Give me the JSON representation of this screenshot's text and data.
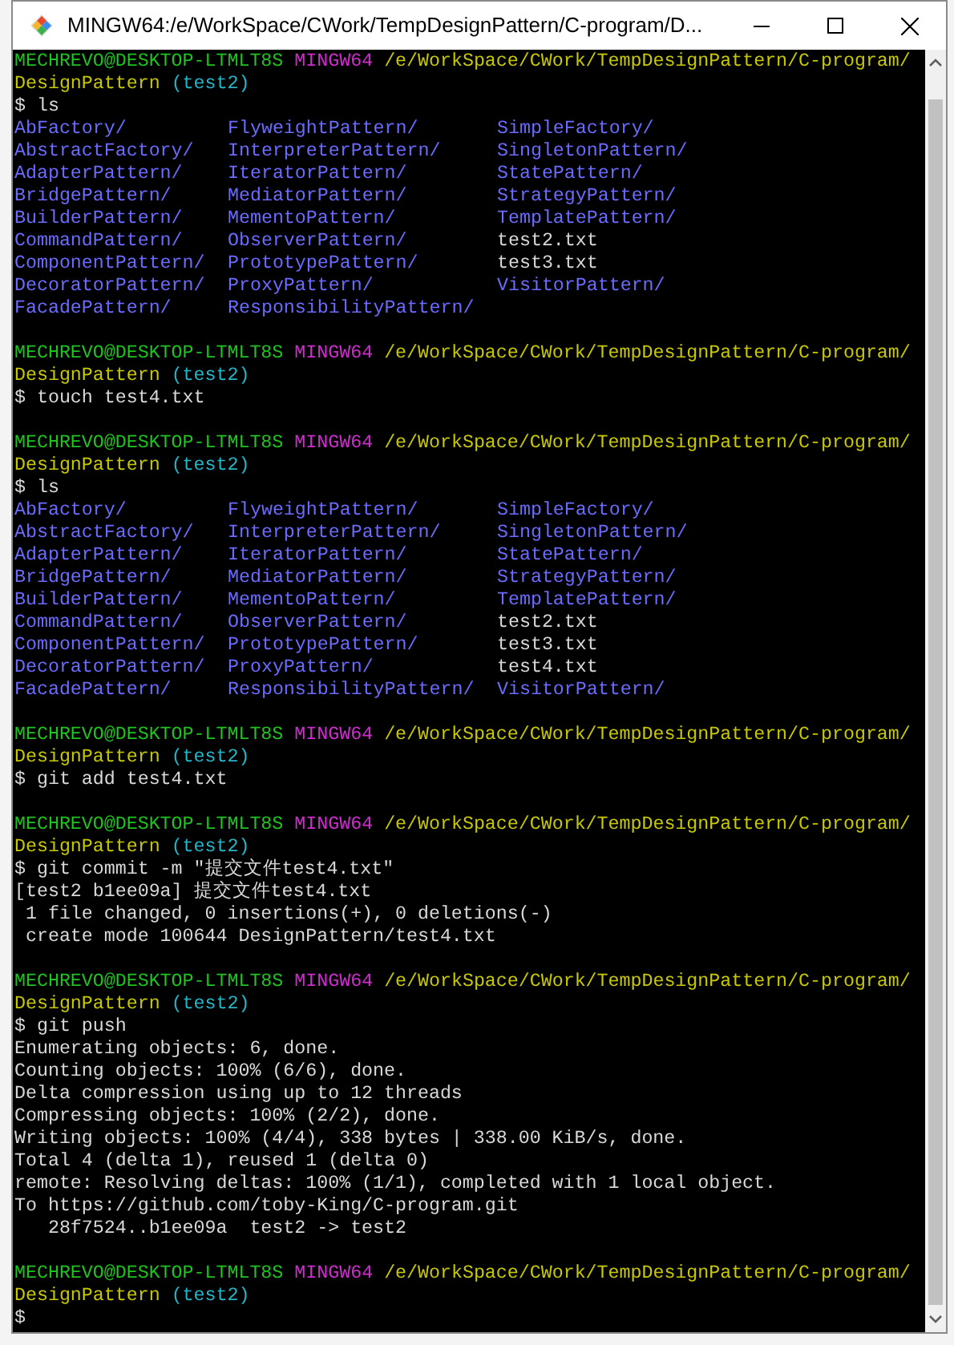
{
  "window": {
    "title": "MINGW64:/e/WorkSpace/CWork/TempDesignPattern/C-program/D..."
  },
  "sessions": [
    {
      "prompt": {
        "user": "MECHREVO@DESKTOP-LTMLT8S",
        "system": "MINGW64",
        "path": "/e/WorkSpace/CWork/TempDesignPattern/C-program/",
        "path_continued": "DesignPattern",
        "branch": "(test2)"
      },
      "command": "$ ls",
      "output": [
        {
          "kind": "listing",
          "rows": [
            [
              {
                "name": "AbFactory/",
                "kind": "dir"
              },
              {
                "name": "FlyweightPattern/",
                "kind": "dir"
              },
              {
                "name": "SimpleFactory/",
                "kind": "dir"
              }
            ],
            [
              {
                "name": "AbstractFactory/",
                "kind": "dir"
              },
              {
                "name": "InterpreterPattern/",
                "kind": "dir"
              },
              {
                "name": "SingletonPattern/",
                "kind": "dir"
              }
            ],
            [
              {
                "name": "AdapterPattern/",
                "kind": "dir"
              },
              {
                "name": "IteratorPattern/",
                "kind": "dir"
              },
              {
                "name": "StatePattern/",
                "kind": "dir"
              }
            ],
            [
              {
                "name": "BridgePattern/",
                "kind": "dir"
              },
              {
                "name": "MediatorPattern/",
                "kind": "dir"
              },
              {
                "name": "StrategyPattern/",
                "kind": "dir"
              }
            ],
            [
              {
                "name": "BuilderPattern/",
                "kind": "dir"
              },
              {
                "name": "MementoPattern/",
                "kind": "dir"
              },
              {
                "name": "TemplatePattern/",
                "kind": "dir"
              }
            ],
            [
              {
                "name": "CommandPattern/",
                "kind": "dir"
              },
              {
                "name": "ObserverPattern/",
                "kind": "dir"
              },
              {
                "name": "test2.txt",
                "kind": "file"
              }
            ],
            [
              {
                "name": "ComponentPattern/",
                "kind": "dir"
              },
              {
                "name": "PrototypePattern/",
                "kind": "dir"
              },
              {
                "name": "test3.txt",
                "kind": "file"
              }
            ],
            [
              {
                "name": "DecoratorPattern/",
                "kind": "dir"
              },
              {
                "name": "ProxyPattern/",
                "kind": "dir"
              },
              {
                "name": "VisitorPattern/",
                "kind": "dir"
              }
            ],
            [
              {
                "name": "FacadePattern/",
                "kind": "dir"
              },
              {
                "name": "ResponsibilityPattern/",
                "kind": "dir"
              }
            ]
          ]
        }
      ]
    },
    {
      "prompt": {
        "user": "MECHREVO@DESKTOP-LTMLT8S",
        "system": "MINGW64",
        "path": "/e/WorkSpace/CWork/TempDesignPattern/C-program/",
        "path_continued": "DesignPattern",
        "branch": "(test2)"
      },
      "command": "$ touch test4.txt"
    },
    {
      "prompt": {
        "user": "MECHREVO@DESKTOP-LTMLT8S",
        "system": "MINGW64",
        "path": "/e/WorkSpace/CWork/TempDesignPattern/C-program/",
        "path_continued": "DesignPattern",
        "branch": "(test2)"
      },
      "command": "$ ls",
      "output": [
        {
          "kind": "listing",
          "rows": [
            [
              {
                "name": "AbFactory/",
                "kind": "dir"
              },
              {
                "name": "FlyweightPattern/",
                "kind": "dir"
              },
              {
                "name": "SimpleFactory/",
                "kind": "dir"
              }
            ],
            [
              {
                "name": "AbstractFactory/",
                "kind": "dir"
              },
              {
                "name": "InterpreterPattern/",
                "kind": "dir"
              },
              {
                "name": "SingletonPattern/",
                "kind": "dir"
              }
            ],
            [
              {
                "name": "AdapterPattern/",
                "kind": "dir"
              },
              {
                "name": "IteratorPattern/",
                "kind": "dir"
              },
              {
                "name": "StatePattern/",
                "kind": "dir"
              }
            ],
            [
              {
                "name": "BridgePattern/",
                "kind": "dir"
              },
              {
                "name": "MediatorPattern/",
                "kind": "dir"
              },
              {
                "name": "StrategyPattern/",
                "kind": "dir"
              }
            ],
            [
              {
                "name": "BuilderPattern/",
                "kind": "dir"
              },
              {
                "name": "MementoPattern/",
                "kind": "dir"
              },
              {
                "name": "TemplatePattern/",
                "kind": "dir"
              }
            ],
            [
              {
                "name": "CommandPattern/",
                "kind": "dir"
              },
              {
                "name": "ObserverPattern/",
                "kind": "dir"
              },
              {
                "name": "test2.txt",
                "kind": "file"
              }
            ],
            [
              {
                "name": "ComponentPattern/",
                "kind": "dir"
              },
              {
                "name": "PrototypePattern/",
                "kind": "dir"
              },
              {
                "name": "test3.txt",
                "kind": "file"
              }
            ],
            [
              {
                "name": "DecoratorPattern/",
                "kind": "dir"
              },
              {
                "name": "ProxyPattern/",
                "kind": "dir"
              },
              {
                "name": "test4.txt",
                "kind": "file"
              }
            ],
            [
              {
                "name": "FacadePattern/",
                "kind": "dir"
              },
              {
                "name": "ResponsibilityPattern/",
                "kind": "dir"
              },
              {
                "name": "VisitorPattern/",
                "kind": "dir"
              }
            ]
          ]
        }
      ]
    },
    {
      "prompt": {
        "user": "MECHREVO@DESKTOP-LTMLT8S",
        "system": "MINGW64",
        "path": "/e/WorkSpace/CWork/TempDesignPattern/C-program/",
        "path_continued": "DesignPattern",
        "branch": "(test2)"
      },
      "command": "$ git add test4.txt"
    },
    {
      "prompt": {
        "user": "MECHREVO@DESKTOP-LTMLT8S",
        "system": "MINGW64",
        "path": "/e/WorkSpace/CWork/TempDesignPattern/C-program/",
        "path_continued": "DesignPattern",
        "branch": "(test2)"
      },
      "command": "$ git commit -m \"提交文件test4.txt\"",
      "output": [
        {
          "kind": "text",
          "lines": [
            "[test2 b1ee09a] 提交文件test4.txt",
            " 1 file changed, 0 insertions(+), 0 deletions(-)",
            " create mode 100644 DesignPattern/test4.txt"
          ]
        }
      ]
    },
    {
      "prompt": {
        "user": "MECHREVO@DESKTOP-LTMLT8S",
        "system": "MINGW64",
        "path": "/e/WorkSpace/CWork/TempDesignPattern/C-program/",
        "path_continued": "DesignPattern",
        "branch": "(test2)"
      },
      "command": "$ git push",
      "output": [
        {
          "kind": "text",
          "lines": [
            "Enumerating objects: 6, done.",
            "Counting objects: 100% (6/6), done.",
            "Delta compression using up to 12 threads",
            "Compressing objects: 100% (2/2), done.",
            "Writing objects: 100% (4/4), 338 bytes | 338.00 KiB/s, done.",
            "Total 4 (delta 1), reused 1 (delta 0)",
            "remote: Resolving deltas: 100% (1/1), completed with 1 local object.",
            "To https://github.com/toby-King/C-program.git",
            "   28f7524..b1ee09a  test2 -> test2"
          ]
        }
      ]
    },
    {
      "prompt": {
        "user": "MECHREVO@DESKTOP-LTMLT8S",
        "system": "MINGW64",
        "path": "/e/WorkSpace/CWork/TempDesignPattern/C-program/",
        "path_continued": "DesignPattern",
        "branch": "(test2)"
      },
      "command": "$"
    }
  ]
}
